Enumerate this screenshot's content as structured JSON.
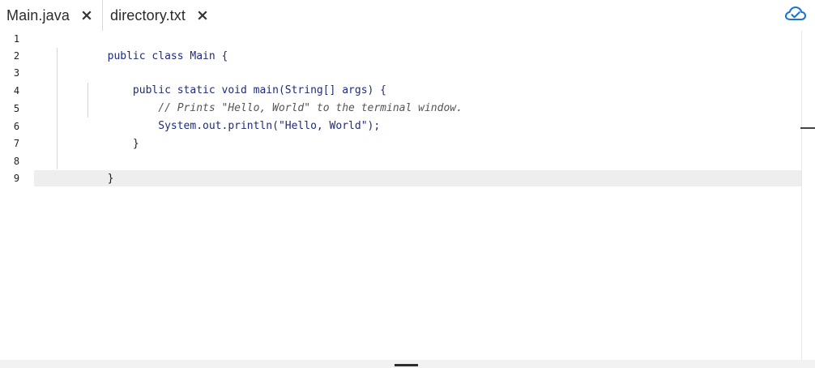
{
  "tabs": [
    {
      "label": "Main.java",
      "close_icon": "close-icon"
    },
    {
      "label": "directory.txt",
      "close_icon": "close-icon"
    }
  ],
  "header": {
    "status_icon": "cloud-check-icon"
  },
  "editor": {
    "line_numbers": [
      "1",
      "2",
      "3",
      "4",
      "5",
      "6",
      "7",
      "8",
      "9"
    ],
    "lines": [
      "public class Main {",
      "",
      "    public static void main(String[] args) {",
      "        // Prints \"Hello, World\" to the terminal window.",
      "        System.out.println(\"Hello, World\");",
      "    }",
      "",
      "}",
      ""
    ]
  },
  "colors": {
    "accent": "#1976d2",
    "keyword": "#1f2b7a",
    "string": "#8a4b1f",
    "comment": "#555555",
    "current_line": "#eeeeee"
  }
}
